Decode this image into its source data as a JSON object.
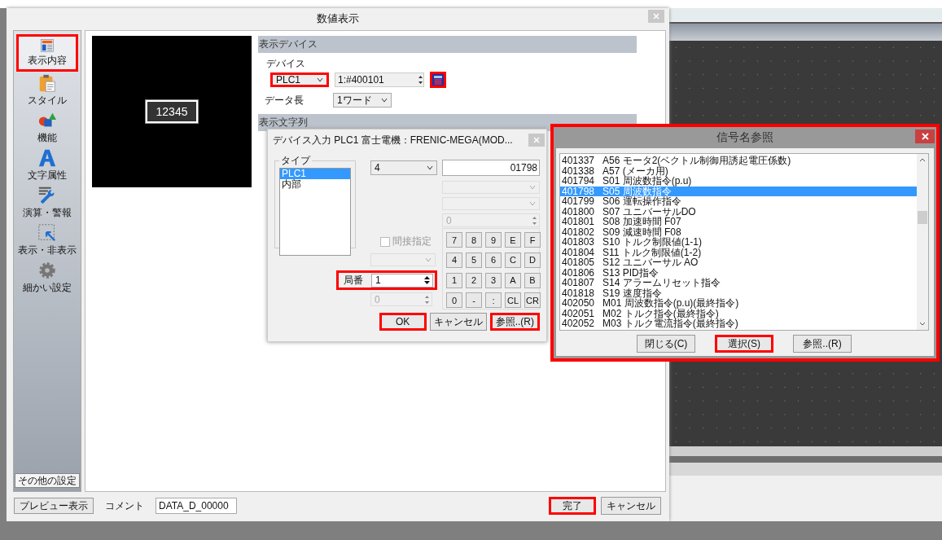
{
  "main_dialog": {
    "title": "数値表示",
    "sidebar": {
      "items": [
        {
          "label": "表示内容",
          "kind": "content",
          "selected": true,
          "highlighted": true
        },
        {
          "label": "スタイル",
          "kind": "style",
          "selected": false,
          "highlighted": false
        },
        {
          "label": "機能",
          "kind": "function",
          "selected": false,
          "highlighted": false
        },
        {
          "label": "文字属性",
          "kind": "font",
          "selected": false,
          "highlighted": false
        },
        {
          "label": "演算・警報",
          "kind": "calc",
          "selected": false,
          "highlighted": false
        },
        {
          "label": "表示・非表示",
          "kind": "visibility",
          "selected": false,
          "highlighted": false
        },
        {
          "label": "細かい設定",
          "kind": "settings",
          "selected": false,
          "highlighted": false
        }
      ],
      "more_settings": "その他の設定"
    },
    "preview_value": "12345",
    "display_device": {
      "header": "表示デバイス",
      "device_label": "デバイス",
      "device_select": {
        "value": "PLC1",
        "highlighted": true
      },
      "address": "1:#400101",
      "calc_button": {
        "highlighted": true
      },
      "data_length_label": "データ長",
      "data_length": "1ワード"
    },
    "display_string": {
      "header": "表示文字列"
    },
    "footer": {
      "preview_button": "プレビュー表示",
      "comment_label": "コメント",
      "comment": "DATA_D_00000",
      "buttons": [
        {
          "label": "完了",
          "highlighted": true
        },
        {
          "label": "キャンセル",
          "highlighted": false
        }
      ]
    }
  },
  "device_input_dialog": {
    "title": "デバイス入力  PLC1 富士電機：FRENIC-MEGA(MOD...",
    "type_group": {
      "label": "タイプ",
      "items": [
        {
          "label": "PLC1",
          "selected": true
        },
        {
          "label": "内部",
          "selected": false
        }
      ]
    },
    "device_type": "4",
    "address": "01798",
    "sub_value": "0",
    "indirect": {
      "label": "間接指定",
      "checked": false,
      "disabled": true
    },
    "station": {
      "label": "局番",
      "value": "1",
      "highlighted": true
    },
    "station_sub_value": "0",
    "keypad": [
      "7",
      "8",
      "9",
      "E",
      "F",
      "4",
      "5",
      "6",
      "C",
      "D",
      "1",
      "2",
      "3",
      "A",
      "B",
      "0",
      "-",
      ":",
      "CL",
      "CR"
    ],
    "buttons": [
      {
        "label": "OK",
        "highlighted": true
      },
      {
        "label": "キャンセル",
        "highlighted": false
      },
      {
        "label": "参照..(R)",
        "highlighted": true
      }
    ]
  },
  "signal_dialog": {
    "title": "信号名参照",
    "highlighted": true,
    "rows": [
      {
        "code": "401337",
        "name": "A56 モータ2(ベクトル制御用誘起電圧係数)",
        "selected": false
      },
      {
        "code": "401338",
        "name": "A57 (メーカ用)",
        "selected": false
      },
      {
        "code": "401794",
        "name": "S01 周波数指令(p.u)",
        "selected": false
      },
      {
        "code": "401798",
        "name": "S05 周波数指令",
        "selected": true
      },
      {
        "code": "401799",
        "name": "S06 運転操作指令",
        "selected": false
      },
      {
        "code": "401800",
        "name": "S07 ユニバーサルDO",
        "selected": false
      },
      {
        "code": "401801",
        "name": "S08 加速時間 F07",
        "selected": false
      },
      {
        "code": "401802",
        "name": "S09 減速時間 F08",
        "selected": false
      },
      {
        "code": "401803",
        "name": "S10 トルク制限値(1-1)",
        "selected": false
      },
      {
        "code": "401804",
        "name": "S11 トルク制限値(1-2)",
        "selected": false
      },
      {
        "code": "401805",
        "name": "S12 ユニバーサル AO",
        "selected": false
      },
      {
        "code": "401806",
        "name": "S13 PID指令",
        "selected": false
      },
      {
        "code": "401807",
        "name": "S14 アラームリセット指令",
        "selected": false
      },
      {
        "code": "401818",
        "name": "S19 速度指令",
        "selected": false
      },
      {
        "code": "402050",
        "name": "M01 周波数指令(p.u)(最終指令)",
        "selected": false
      },
      {
        "code": "402051",
        "name": "M02 トルク指令(最終指令)",
        "selected": false
      },
      {
        "code": "402052",
        "name": "M03 トルク電流指令(最終指令)",
        "selected": false
      }
    ],
    "buttons": [
      {
        "label": "閉じる(C)",
        "highlighted": false
      },
      {
        "label": "選択(S)",
        "highlighted": true
      },
      {
        "label": "参照..(R)",
        "highlighted": false
      }
    ]
  }
}
